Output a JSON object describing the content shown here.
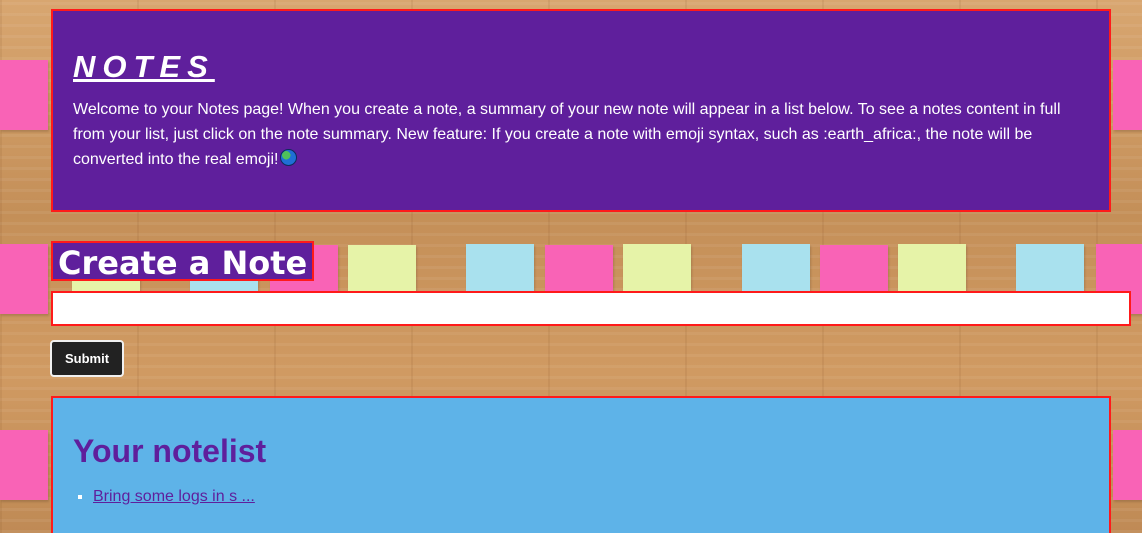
{
  "header": {
    "title": "NOTES",
    "intro_text": "Welcome to your Notes page! When you create a note, a summary of your new note will appear in a list below. To see a notes content in full from your list, just click on the note summary. New feature: If you create a note with emoji syntax, such as :earth_africa:, the note will be converted into the real emoji!",
    "emoji_icon": "earth-africa-icon"
  },
  "create": {
    "title": "Create a Note",
    "input_value": "",
    "input_placeholder": "",
    "submit_label": "Submit"
  },
  "notelist": {
    "title": "Your notelist",
    "items": [
      {
        "label": "Bring some logs in s ..."
      }
    ]
  },
  "colors": {
    "header_bg": "#5f1f9c",
    "border": "#ff1a1a",
    "notelist_bg": "#5eb3e8",
    "button_bg": "#222222"
  }
}
